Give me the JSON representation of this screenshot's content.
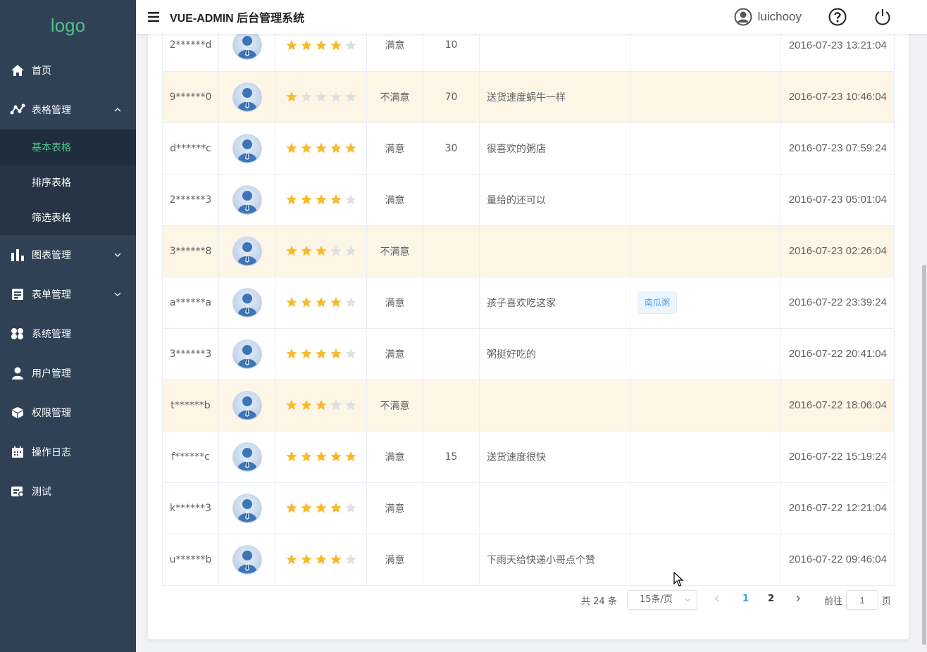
{
  "sidebar": {
    "logo": "logo",
    "items": [
      {
        "label": "首页",
        "icon": "home-icon"
      },
      {
        "label": "表格管理",
        "icon": "table-graph-icon",
        "expanded": true
      },
      {
        "label": "图表管理",
        "icon": "bar-chart-icon"
      },
      {
        "label": "表单管理",
        "icon": "form-icon"
      },
      {
        "label": "系统管理",
        "icon": "system-icon"
      },
      {
        "label": "用户管理",
        "icon": "user-icon"
      },
      {
        "label": "权限管理",
        "icon": "cube-icon"
      },
      {
        "label": "操作日志",
        "icon": "calendar-icon"
      },
      {
        "label": "测试",
        "icon": "test-icon"
      }
    ],
    "sub_items": [
      {
        "label": "基本表格",
        "active": true
      },
      {
        "label": "排序表格"
      },
      {
        "label": "筛选表格"
      }
    ]
  },
  "header": {
    "title": "VUE-ADMIN 后台管理系统",
    "username": "luichooy"
  },
  "table": {
    "rows": [
      {
        "user": "2******d",
        "rating": 4,
        "status": "满意",
        "count": "10",
        "comment": "",
        "tag": "",
        "time": "2016-07-23 13:21:04",
        "warn": false
      },
      {
        "user": "9******0",
        "rating": 1,
        "status": "不满意",
        "count": "70",
        "comment": "送货速度蜗牛一样",
        "tag": "",
        "time": "2016-07-23 10:46:04",
        "warn": true
      },
      {
        "user": "d******c",
        "rating": 5,
        "status": "满意",
        "count": "30",
        "comment": "很喜欢的粥店",
        "tag": "",
        "time": "2016-07-23 07:59:24",
        "warn": false
      },
      {
        "user": "2******3",
        "rating": 4,
        "status": "满意",
        "count": "",
        "comment": "量给的还可以",
        "tag": "",
        "time": "2016-07-23 05:01:04",
        "warn": false
      },
      {
        "user": "3******8",
        "rating": 3,
        "status": "不满意",
        "count": "",
        "comment": "",
        "tag": "",
        "time": "2016-07-23 02:26:04",
        "warn": true
      },
      {
        "user": "a******a",
        "rating": 4,
        "status": "满意",
        "count": "",
        "comment": "孩子喜欢吃这家",
        "tag": "南瓜粥",
        "time": "2016-07-22 23:39:24",
        "warn": false
      },
      {
        "user": "3******3",
        "rating": 4,
        "status": "满意",
        "count": "",
        "comment": "粥挺好吃的",
        "tag": "",
        "time": "2016-07-22 20:41:04",
        "warn": false
      },
      {
        "user": "t******b",
        "rating": 3,
        "status": "不满意",
        "count": "",
        "comment": "",
        "tag": "",
        "time": "2016-07-22 18:06:04",
        "warn": true
      },
      {
        "user": "f******c",
        "rating": 5,
        "status": "满意",
        "count": "15",
        "comment": "送货速度很快",
        "tag": "",
        "time": "2016-07-22 15:19:24",
        "warn": false
      },
      {
        "user": "k******3",
        "rating": 4,
        "status": "满意",
        "count": "",
        "comment": "",
        "tag": "",
        "time": "2016-07-22 12:21:04",
        "warn": false
      },
      {
        "user": "u******b",
        "rating": 4,
        "status": "满意",
        "count": "",
        "comment": "下雨天给快递小哥点个赞",
        "tag": "",
        "time": "2016-07-22 09:46:04",
        "warn": false
      }
    ]
  },
  "pagination": {
    "total": "共 24 条",
    "page_size": "15条/页",
    "pages": [
      "1",
      "2"
    ],
    "current": "1",
    "goto_label": "前往",
    "goto_value": "1",
    "page_suffix": "页"
  },
  "colors": {
    "sidebar_bg": "#304156",
    "active_text": "#4fc08d",
    "star_on": "#f7ba2a",
    "star_off": "#e0e0e0",
    "warning_row": "#fdf5e6",
    "primary": "#409eff"
  }
}
